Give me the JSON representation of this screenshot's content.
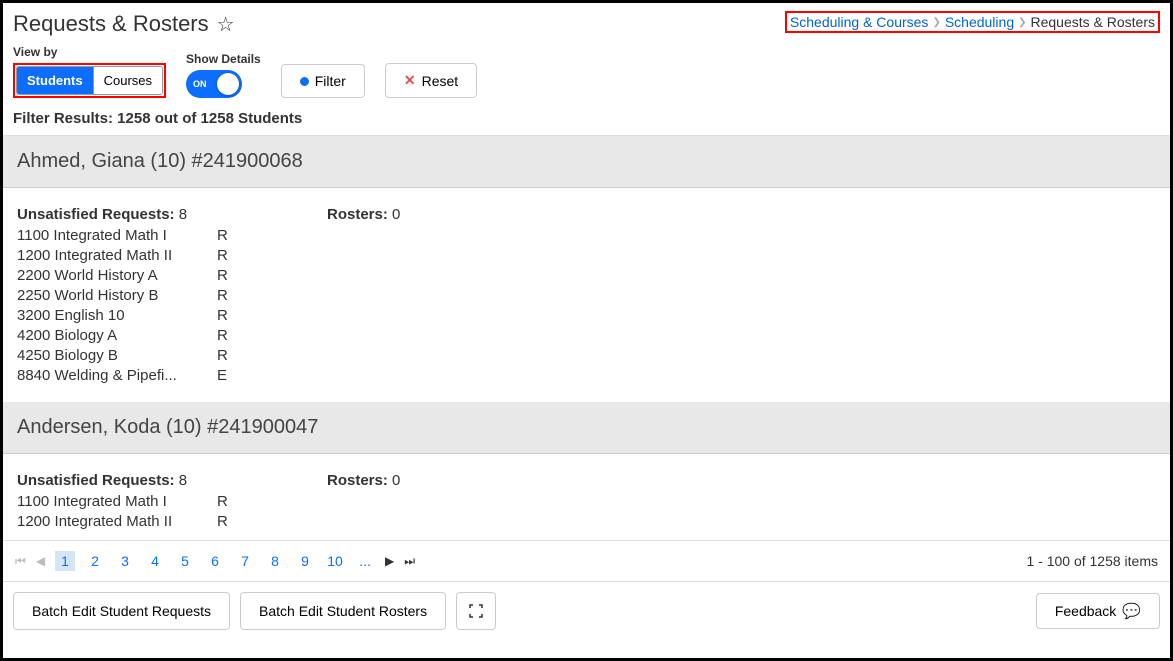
{
  "header": {
    "title": "Requests & Rosters",
    "breadcrumb": {
      "item1": "Scheduling & Courses",
      "item2": "Scheduling",
      "item3": "Requests & Rosters"
    }
  },
  "controls": {
    "viewby_label": "View by",
    "viewby_students": "Students",
    "viewby_courses": "Courses",
    "showdetails_label": "Show Details",
    "toggle_text": "ON",
    "filter_label": "Filter",
    "reset_label": "Reset"
  },
  "filter_results": "Filter Results: 1258 out of 1258 Students",
  "students": [
    {
      "header": "Ahmed, Giana (10) #241900068",
      "unsatisfied_label": "Unsatisfied Requests:",
      "unsatisfied_count": "8",
      "rosters_label": "Rosters:",
      "rosters_count": "0",
      "requests": [
        {
          "course": "1100 Integrated Math I",
          "type": "R"
        },
        {
          "course": "1200 Integrated Math II",
          "type": "R"
        },
        {
          "course": "2200 World History A",
          "type": "R"
        },
        {
          "course": "2250 World History B",
          "type": "R"
        },
        {
          "course": "3200 English 10",
          "type": "R"
        },
        {
          "course": "4200 Biology A",
          "type": "R"
        },
        {
          "course": "4250 Biology B",
          "type": "R"
        },
        {
          "course": "8840 Welding & Pipefi...",
          "type": "E"
        }
      ]
    },
    {
      "header": "Andersen, Koda (10) #241900047",
      "unsatisfied_label": "Unsatisfied Requests:",
      "unsatisfied_count": "8",
      "rosters_label": "Rosters:",
      "rosters_count": "0",
      "requests": [
        {
          "course": "1100 Integrated Math I",
          "type": "R"
        },
        {
          "course": "1200 Integrated Math II",
          "type": "R"
        }
      ]
    }
  ],
  "pager": {
    "pages": [
      "1",
      "2",
      "3",
      "4",
      "5",
      "6",
      "7",
      "8",
      "9",
      "10",
      "..."
    ],
    "summary": "1 - 100 of 1258 items"
  },
  "footer": {
    "batch_requests": "Batch Edit Student Requests",
    "batch_rosters": "Batch Edit Student Rosters",
    "feedback": "Feedback"
  }
}
